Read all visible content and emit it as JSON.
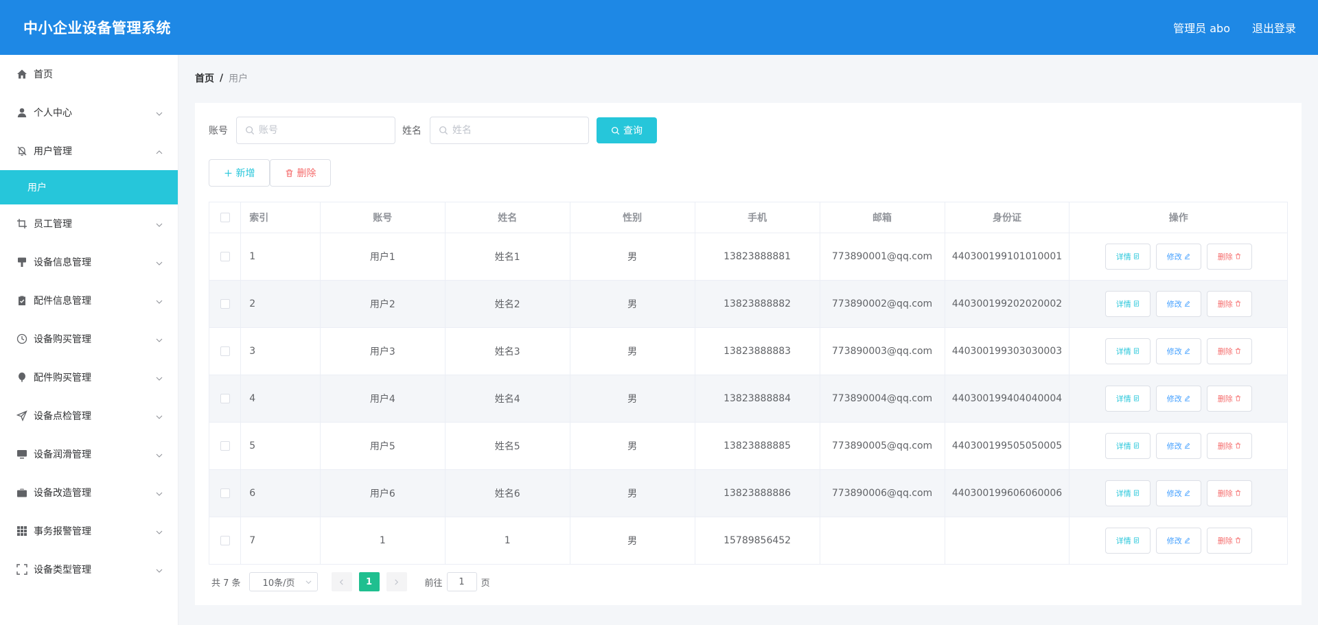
{
  "header": {
    "title": "中小企业设备管理系统",
    "user": "管理员 abo",
    "logout": "退出登录"
  },
  "sidebar": {
    "items": [
      {
        "label": "首页",
        "icon": "home-icon"
      },
      {
        "label": "个人中心",
        "icon": "user-icon"
      },
      {
        "label": "用户管理",
        "icon": "bell-off-icon",
        "expanded": true
      },
      {
        "label": "员工管理",
        "icon": "crop-icon"
      },
      {
        "label": "设备信息管理",
        "icon": "brush-icon"
      },
      {
        "label": "配件信息管理",
        "icon": "clipboard-icon"
      },
      {
        "label": "设备购买管理",
        "icon": "clock-icon"
      },
      {
        "label": "配件购买管理",
        "icon": "balloon-icon"
      },
      {
        "label": "设备点检管理",
        "icon": "send-icon"
      },
      {
        "label": "设备润滑管理",
        "icon": "monitor-icon"
      },
      {
        "label": "设备改造管理",
        "icon": "suitcase-icon"
      },
      {
        "label": "事务报警管理",
        "icon": "grid-icon"
      },
      {
        "label": "设备类型管理",
        "icon": "fullscreen-icon"
      }
    ],
    "submenu_active": "用户"
  },
  "breadcrumb": {
    "home": "首页",
    "separator": "/",
    "current": "用户"
  },
  "search": {
    "account_label": "账号",
    "account_placeholder": "账号",
    "name_label": "姓名",
    "name_placeholder": "姓名",
    "query_button": "查询"
  },
  "actions": {
    "add": "新增",
    "delete": "删除"
  },
  "table": {
    "columns": [
      "索引",
      "账号",
      "姓名",
      "性别",
      "手机",
      "邮箱",
      "身份证",
      "操作"
    ],
    "rows": [
      {
        "index": "1",
        "account": "用户1",
        "name": "姓名1",
        "gender": "男",
        "phone": "13823888881",
        "email": "773890001@qq.com",
        "idcard": "440300199101010001"
      },
      {
        "index": "2",
        "account": "用户2",
        "name": "姓名2",
        "gender": "男",
        "phone": "13823888882",
        "email": "773890002@qq.com",
        "idcard": "440300199202020002"
      },
      {
        "index": "3",
        "account": "用户3",
        "name": "姓名3",
        "gender": "男",
        "phone": "13823888883",
        "email": "773890003@qq.com",
        "idcard": "440300199303030003"
      },
      {
        "index": "4",
        "account": "用户4",
        "name": "姓名4",
        "gender": "男",
        "phone": "13823888884",
        "email": "773890004@qq.com",
        "idcard": "440300199404040004"
      },
      {
        "index": "5",
        "account": "用户5",
        "name": "姓名5",
        "gender": "男",
        "phone": "13823888885",
        "email": "773890005@qq.com",
        "idcard": "440300199505050005"
      },
      {
        "index": "6",
        "account": "用户6",
        "name": "姓名6",
        "gender": "男",
        "phone": "13823888886",
        "email": "773890006@qq.com",
        "idcard": "440300199606060006"
      },
      {
        "index": "7",
        "account": "1",
        "name": "1",
        "gender": "男",
        "phone": "15789856452",
        "email": "",
        "idcard": ""
      }
    ],
    "row_actions": {
      "detail": "详情",
      "edit": "修改",
      "delete": "删除"
    }
  },
  "pagination": {
    "total": "共 7 条",
    "page_size": "10条/页",
    "current_page": "1",
    "goto_label": "前往",
    "goto_value": "1",
    "page_unit": "页"
  },
  "colors": {
    "header_bg": "#1e88e5",
    "accent": "#26c6da",
    "danger": "#f56c6c",
    "edit": "#409eff",
    "page_active": "#1fbf8f"
  }
}
